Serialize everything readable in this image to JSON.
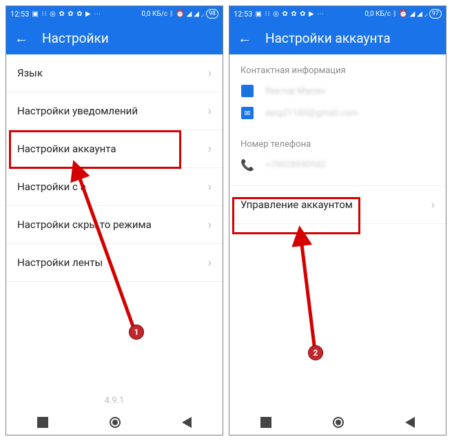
{
  "left": {
    "status": {
      "time": "12:53",
      "net": "0,0 КБ/с",
      "battery": "98"
    },
    "title": "Настройки",
    "items": [
      {
        "label": "Язык"
      },
      {
        "label": "Настройки уведомлений"
      },
      {
        "label": "Настройки аккаунта"
      },
      {
        "label": "Настройки с         а"
      },
      {
        "label": "Настройки скры   то режима"
      },
      {
        "label": "Настройки ленты"
      }
    ],
    "version": "4.9.1",
    "badge": "1"
  },
  "right": {
    "status": {
      "time": "12:53",
      "net": "0,0 КБ/с",
      "battery": "97"
    },
    "title": "Настройки аккаунта",
    "section_contact": "Контактная информация",
    "contact_name": "Виктор Макин",
    "contact_email": "serg21185@gmail.com",
    "section_phone": "Номер телефона",
    "phone": "+79028990942",
    "manage": "Управление аккаунтом",
    "badge": "2"
  }
}
